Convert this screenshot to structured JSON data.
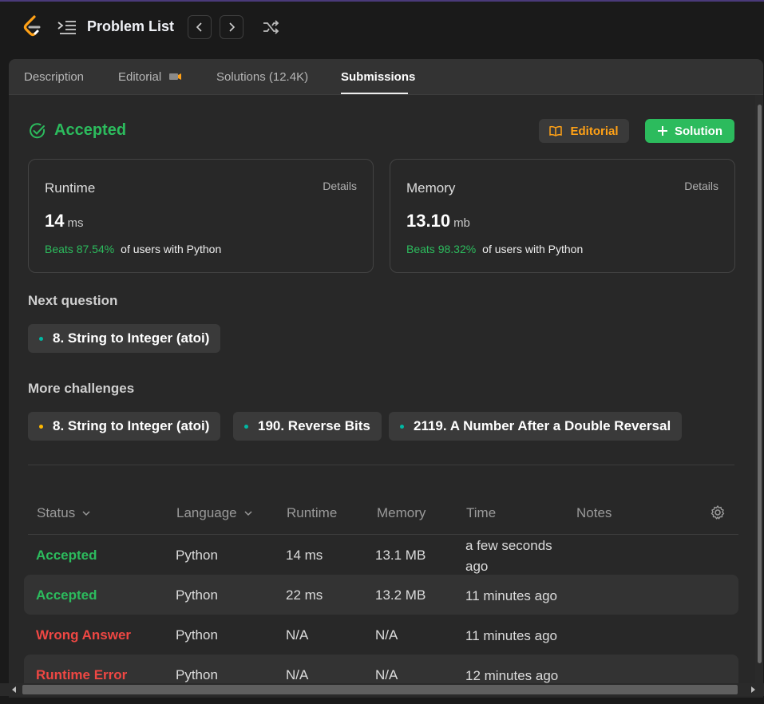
{
  "header": {
    "title": "Problem List",
    "icons": [
      "leetcode-logo",
      "list-icon",
      "chevron-left-icon",
      "chevron-right-icon",
      "shuffle-icon"
    ]
  },
  "tabs": [
    {
      "label": "Description"
    },
    {
      "label": "Editorial"
    },
    {
      "label": "Solutions (12.4K)"
    },
    {
      "label": "Submissions",
      "active": true
    }
  ],
  "result": {
    "status": "Accepted",
    "editorial_button": "Editorial",
    "solution_button": "Solution"
  },
  "runtime": {
    "label": "Runtime",
    "details": "Details",
    "value": "14",
    "unit": "ms",
    "beats": "Beats 87.54%",
    "beats_suffix": "of users with Python"
  },
  "memory": {
    "label": "Memory",
    "details": "Details",
    "value": "13.10",
    "unit": "mb",
    "beats": "Beats 98.32%",
    "beats_suffix": "of users with Python"
  },
  "next_question": {
    "label": "Next question",
    "item": "8. String to Integer (atoi)"
  },
  "more_challenges": {
    "label": "More challenges",
    "items": [
      {
        "title": "8. String to Integer (atoi)",
        "color": "#ffb800"
      },
      {
        "title": "190. Reverse Bits",
        "color": "#00b8a3"
      },
      {
        "title": "2119. A Number After a Double Reversal",
        "color": "#00b8a3"
      }
    ]
  },
  "table": {
    "headers": [
      "Status",
      "Language",
      "Runtime",
      "Memory",
      "Time",
      "Notes"
    ],
    "rows": [
      {
        "status": "Accepted",
        "language": "Python",
        "runtime": "14 ms",
        "memory": "13.1 MB",
        "time_line1": "a few seconds",
        "time_line2": "ago"
      },
      {
        "status": "Accepted",
        "language": "Python",
        "runtime": "22 ms",
        "memory": "13.2 MB",
        "time": "11 minutes ago"
      },
      {
        "status": "Wrong Answer",
        "language": "Python",
        "runtime": "N/A",
        "memory": "N/A",
        "time": "11 minutes ago"
      },
      {
        "status": "Runtime Error",
        "language": "Python",
        "runtime": "N/A",
        "memory": "N/A",
        "time": "12 minutes ago"
      }
    ]
  },
  "colors": {
    "accepted": "#2cbb5d",
    "error": "#ef4743",
    "easy": "#00b8a3",
    "medium": "#ffb800",
    "brand": "#ffa116"
  }
}
